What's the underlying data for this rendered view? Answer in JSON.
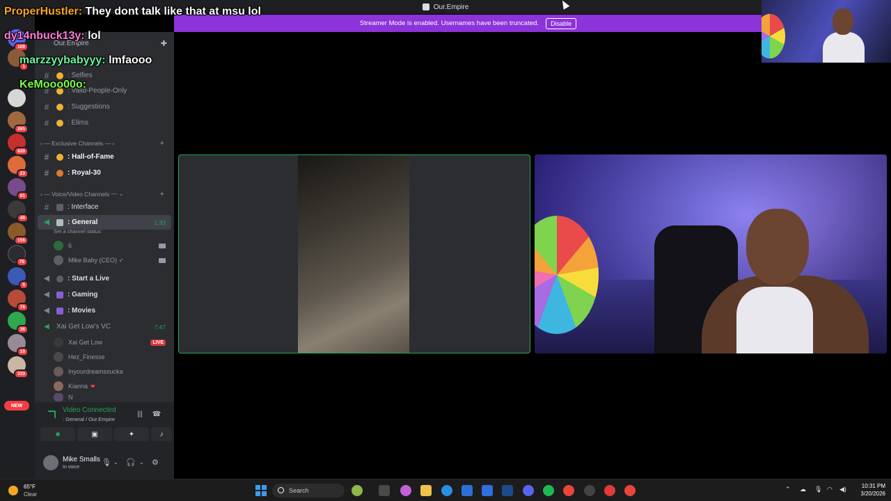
{
  "titlebar": {
    "title": "Our.Empire"
  },
  "banner": {
    "message": "Streamer Mode is enabled. Usernames have been truncated.",
    "button": "Disable"
  },
  "chat": [
    {
      "name": "ProperHustler:",
      "text": "They dont talk like that at msu lol"
    },
    {
      "name": "dy14nbuck13y:",
      "text": "lol"
    },
    {
      "name": "marzzyybabyyy:",
      "text": "lmfaooo"
    },
    {
      "name": "KeMooo00o:",
      "text": ""
    }
  ],
  "server_rail": {
    "badges": [
      "109",
      "1",
      "285",
      "820",
      "23",
      "81",
      "49",
      "156",
      "75",
      "6",
      "76",
      "36",
      "10",
      "333"
    ],
    "new_label": "NEW"
  },
  "sidebar": {
    "server_name": "Our.Empire",
    "channels": [
      {
        "name": ": Selfies"
      },
      {
        "name": ": Valid-People-Only"
      },
      {
        "name": ": Suggestions"
      },
      {
        "name": ": Elims"
      }
    ],
    "exclusive_category": "Exclusive Channels",
    "exclusive": [
      {
        "name": ": Hall-of-Fame"
      },
      {
        "name": ": Royal-30"
      }
    ],
    "voice_category": "Voice/Video Channels",
    "interface": ": Interface",
    "general": {
      "name": ": General",
      "duration": "1:33",
      "status": "Set a channel status"
    },
    "general_users": [
      "6",
      "Mike Baby (CEO) ✓"
    ],
    "voice_channels": [
      ": Start a Live",
      ": Gaming",
      ": Movies"
    ],
    "xai": {
      "name": "Xai Get Low's VC",
      "duration": "7:47"
    },
    "xai_users": [
      "Xai Get Low",
      "Hez_Finesse",
      "Inyourdreamssucka",
      "Kianna",
      "N"
    ],
    "live": "LIVE"
  },
  "voice_panel": {
    "status": "Video Connected",
    "location": ": General / Our.Empire"
  },
  "user": {
    "name": "Mike Smalls",
    "status": "In voice"
  },
  "taskbar": {
    "temp": "65°F",
    "condition": "Clear",
    "search": "Search",
    "time": "10:31 PM",
    "date": "3/20/2026"
  }
}
